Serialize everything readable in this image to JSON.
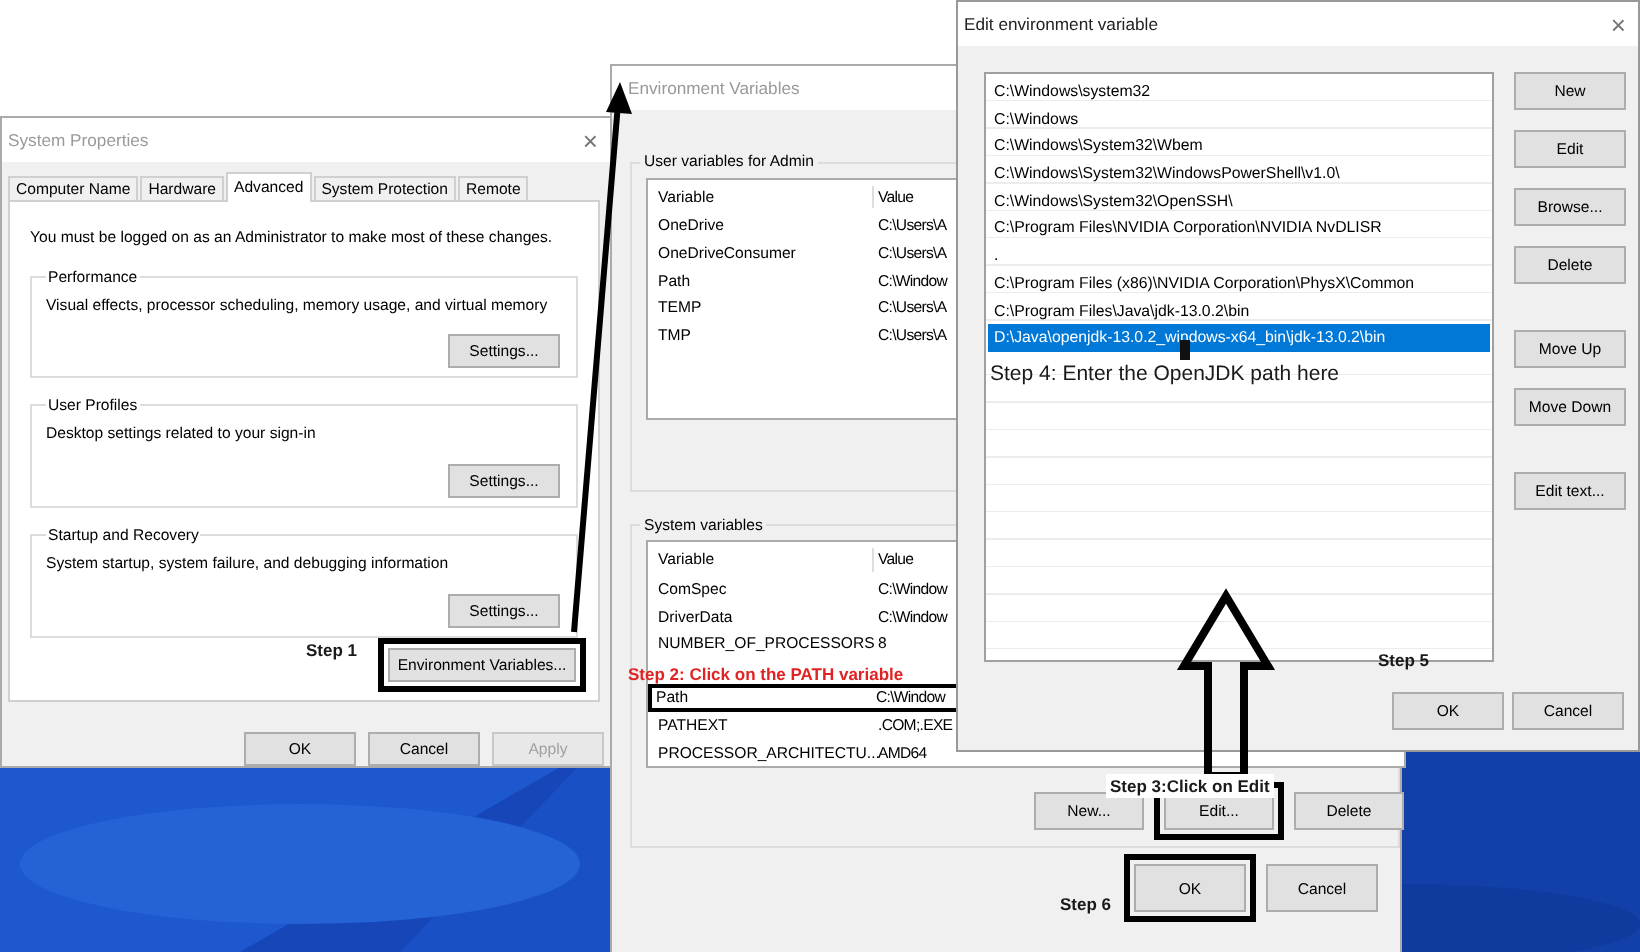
{
  "system_properties": {
    "title": "System Properties",
    "close": "×",
    "tabs": [
      {
        "label": "Computer Name",
        "selected": false
      },
      {
        "label": "Hardware",
        "selected": false
      },
      {
        "label": "Advanced",
        "selected": true
      },
      {
        "label": "System Protection",
        "selected": false
      },
      {
        "label": "Remote",
        "selected": false
      }
    ],
    "notice": "You must be logged on as an Administrator to make most of these changes.",
    "groups": [
      {
        "title": "Performance",
        "description": "Visual effects, processor scheduling, memory usage, and virtual memory",
        "button": "Settings..."
      },
      {
        "title": "User Profiles",
        "description": "Desktop settings related to your sign-in",
        "button": "Settings..."
      },
      {
        "title": "Startup and Recovery",
        "description": "System startup, system failure, and debugging information",
        "button": "Settings..."
      }
    ],
    "env_button": {
      "label": "Environment Variables...",
      "highlighted": true
    },
    "buttons": [
      {
        "label": "OK",
        "disabled": false
      },
      {
        "label": "Cancel",
        "disabled": false
      },
      {
        "label": "Apply",
        "disabled": true
      }
    ]
  },
  "environment_variables": {
    "title": "Environment Variables",
    "user_section": {
      "title": "User variables for Admin",
      "columns": [
        "Variable",
        "Value"
      ],
      "rows": [
        {
          "variable": "OneDrive",
          "value": "C:\\Users\\A",
          "highlighted": false
        },
        {
          "variable": "OneDriveConsumer",
          "value": "C:\\Users\\A",
          "highlighted": false
        },
        {
          "variable": "Path",
          "value": "C:\\Window",
          "highlighted": false
        },
        {
          "variable": "TEMP",
          "value": "C:\\Users\\A",
          "highlighted": false
        },
        {
          "variable": "TMP",
          "value": "C:\\Users\\A",
          "highlighted": false
        }
      ]
    },
    "system_section": {
      "title": "System variables",
      "columns": [
        "Variable",
        "Value"
      ],
      "rows": [
        {
          "variable": "ComSpec",
          "value": "C:\\Window",
          "highlighted": false
        },
        {
          "variable": "DriverData",
          "value": "C:\\Window",
          "highlighted": false
        },
        {
          "variable": "NUMBER_OF_PROCESSORS",
          "value": "8",
          "highlighted": false
        },
        {
          "variable": "Path",
          "value": "C:\\Window",
          "highlighted": true
        },
        {
          "variable": "PATHEXT",
          "value": ".COM;.EXE",
          "highlighted": false
        },
        {
          "variable": "PROCESSOR_ARCHITECTU...",
          "value": "AMD64",
          "highlighted": false
        }
      ]
    },
    "section_buttons": [
      {
        "label": "New...",
        "highlighted": false
      },
      {
        "label": "Edit...",
        "highlighted": true
      },
      {
        "label": "Delete",
        "highlighted": false
      }
    ],
    "buttons": [
      {
        "label": "OK",
        "highlighted": true
      },
      {
        "label": "Cancel",
        "highlighted": false
      }
    ]
  },
  "edit_dialog": {
    "title": "Edit environment variable",
    "close": "×",
    "entries": [
      {
        "text": "C:\\Windows\\system32",
        "selected": false
      },
      {
        "text": "C:\\Windows",
        "selected": false
      },
      {
        "text": "C:\\Windows\\System32\\Wbem",
        "selected": false
      },
      {
        "text": "C:\\Windows\\System32\\WindowsPowerShell\\v1.0\\",
        "selected": false
      },
      {
        "text": "C:\\Windows\\System32\\OpenSSH\\",
        "selected": false
      },
      {
        "text": "C:\\Program Files\\NVIDIA Corporation\\NVIDIA NvDLISR",
        "selected": false
      },
      {
        "text": ".",
        "selected": false
      },
      {
        "text": "C:\\Program Files (x86)\\NVIDIA Corporation\\PhysX\\Common",
        "selected": false
      },
      {
        "text": "C:\\Program Files\\Java\\jdk-13.0.2\\bin",
        "selected": false
      },
      {
        "text": "D:\\Java\\openjdk-13.0.2_windows-x64_bin\\jdk-13.0.2\\bin",
        "selected": true
      }
    ],
    "side_buttons": [
      {
        "label": "New",
        "kind": "button"
      },
      {
        "label": "Edit",
        "kind": "button"
      },
      {
        "label": "Browse...",
        "kind": "button"
      },
      {
        "label": "Delete",
        "kind": "button"
      },
      {
        "label": "Move Up",
        "kind": "gap-button"
      },
      {
        "label": "Move Down",
        "kind": "button"
      },
      {
        "label": "Edit text...",
        "kind": "gap-button"
      }
    ],
    "buttons": [
      "OK",
      "Cancel"
    ]
  },
  "annotations": [
    {
      "text": "Step 4: Enter the OpenJDK path here",
      "color": "#1a1a1a",
      "kind": "step4"
    },
    {
      "text": "Step 1",
      "color": "#1a1a1a",
      "kind": "step1"
    },
    {
      "text": "Step 5",
      "color": "#1a1a1a",
      "kind": "step5"
    },
    {
      "text": "Step 2: Click on the PATH variable",
      "color": "#e02424",
      "kind": "step2"
    },
    {
      "text": "Step 3:Click on Edit",
      "color": "#1a1a1a",
      "kind": "step3"
    },
    {
      "text": "Step 6",
      "color": "#1a1a1a",
      "kind": "step6"
    }
  ]
}
